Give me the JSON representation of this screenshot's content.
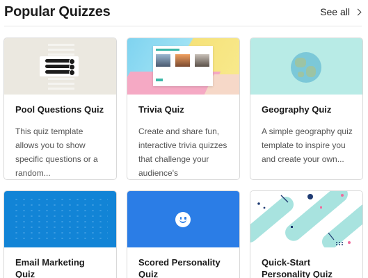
{
  "header": {
    "title": "Popular Quizzes",
    "see_all_label": "See all"
  },
  "cards": [
    {
      "title": "Pool Questions Quiz",
      "description": "This quiz template allows you to show specific questions or a random..."
    },
    {
      "title": "Trivia Quiz",
      "description": "Create and share fun, interactive trivia quizzes that challenge your audience's knowledge...."
    },
    {
      "title": "Geography Quiz",
      "description": "A simple geography quiz template to inspire you and create your own..."
    },
    {
      "title": "Email Marketing Quiz",
      "description": ""
    },
    {
      "title": "Scored Personality Quiz",
      "description": ""
    },
    {
      "title": "Quick-Start Personality Quiz",
      "description": ""
    }
  ],
  "icons": {
    "see_all": "chevron-right-icon",
    "scored": "smiley-icon"
  },
  "colors": {
    "email_thumb": "#1284d6",
    "scored_thumb": "#2b7de6",
    "geography_thumb": "#b8ebe6",
    "pool_thumb": "#ebe8e0"
  }
}
